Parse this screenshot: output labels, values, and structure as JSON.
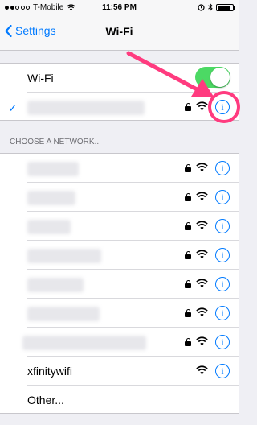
{
  "status_bar": {
    "carrier": "T-Mobile",
    "time": "11:56 PM",
    "battery_level": 0.85,
    "signal_bars_filled": 2
  },
  "nav": {
    "back_label": "Settings",
    "title": "Wi-Fi"
  },
  "wifi_toggle": {
    "label": "Wi-Fi",
    "on": true
  },
  "connected_network": {
    "name": "",
    "selected": true,
    "secured": true
  },
  "section_header": "CHOOSE A NETWORK...",
  "networks": [
    {
      "name": "",
      "secured": true
    },
    {
      "name": "",
      "secured": true
    },
    {
      "name": "",
      "secured": true
    },
    {
      "name": "",
      "secured": true
    },
    {
      "name": "",
      "secured": true
    },
    {
      "name": "",
      "secured": true
    },
    {
      "name": "",
      "secured": true
    },
    {
      "name": "xfinitywifi",
      "secured": false
    }
  ],
  "other_label": "Other...",
  "colors": {
    "accent": "#007aff",
    "toggle_on": "#4cd964",
    "annotation": "#ff3b7f"
  },
  "icons": {
    "info": "i",
    "check": "✓"
  }
}
